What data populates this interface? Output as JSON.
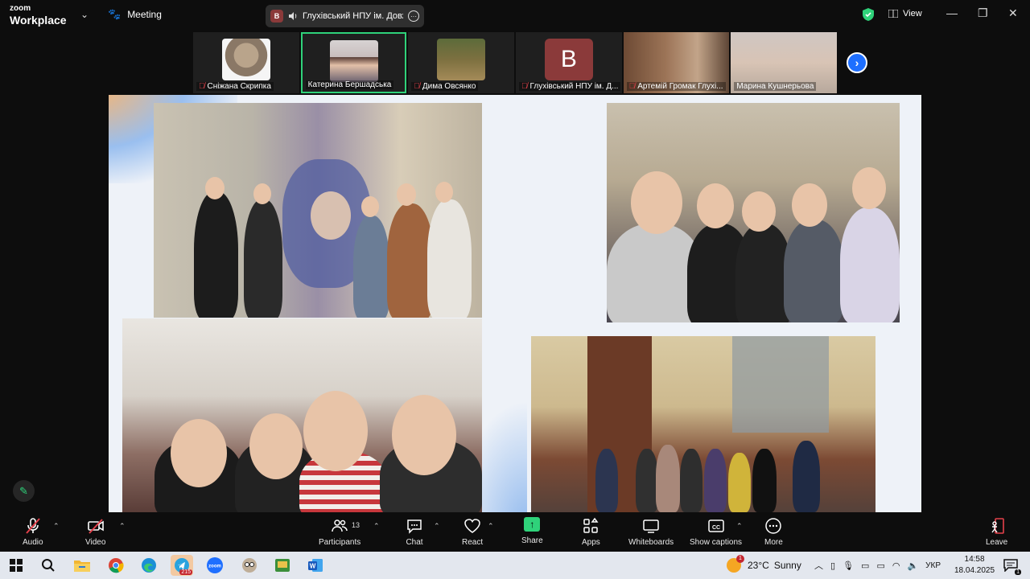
{
  "titlebar": {
    "brand_small": "zoom",
    "brand_large": "Workplace",
    "meeting_label": "Meeting",
    "meeting_host_initial": "B",
    "meeting_name": "Глухівський НПУ ім. Довже",
    "view_label": "View"
  },
  "participants": [
    {
      "name": "Сніжана Скрипка",
      "muted": true,
      "kind": "image",
      "icon": "owl-glasses-avatar"
    },
    {
      "name": "Катерина Бершадська",
      "muted": false,
      "kind": "video",
      "active": true
    },
    {
      "name": "Дима Овсянко",
      "muted": true,
      "kind": "image",
      "icon": "forest-path-avatar"
    },
    {
      "name": "Глухівський НПУ ім. Д...",
      "muted": true,
      "kind": "initial",
      "initial": "B"
    },
    {
      "name": "Артемій Громак Глухі...",
      "muted": true,
      "kind": "video"
    },
    {
      "name": "Марина Кушнерьова",
      "muted": false,
      "kind": "video"
    }
  ],
  "toolbar": {
    "audio": "Audio",
    "video": "Video",
    "participants": "Participants",
    "participants_count": "13",
    "chat": "Chat",
    "react": "React",
    "share": "Share",
    "apps": "Apps",
    "whiteboards": "Whiteboards",
    "show_captions": "Show captions",
    "more": "More",
    "leave": "Leave"
  },
  "taskbar": {
    "telegram_badge": "215",
    "weather_temp": "23°C",
    "weather_text": "Sunny",
    "weather_alert": "1",
    "language": "УКР",
    "time": "14:58",
    "date": "18.04.2025",
    "notifications": "1"
  },
  "colors": {
    "accent_green": "#2fd27a",
    "mute_red": "#e4414b",
    "zoom_blue": "#1e6fff"
  }
}
